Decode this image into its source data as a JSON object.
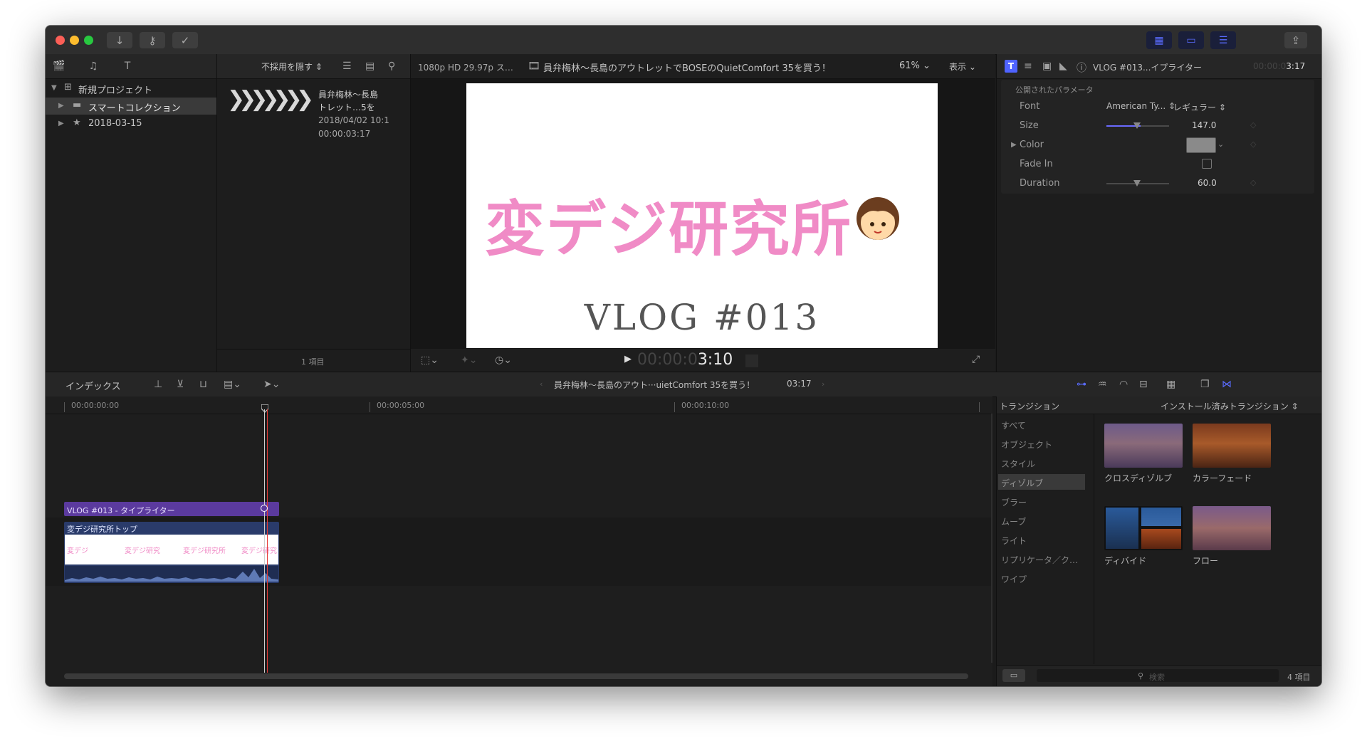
{
  "toolbar": {
    "import_icon": "download-arrow-icon",
    "keyword_icon": "key-icon",
    "background_tasks_icon": "checkmark-circle-icon",
    "share_icon": "share-icon"
  },
  "browser": {
    "filter_label": "不採用を隠す",
    "items": [
      {
        "label": "新規プロジェクト",
        "expanded": true
      },
      {
        "label": "スマートコレクション",
        "selected": true
      },
      {
        "label": "2018-03-15"
      }
    ],
    "clip": {
      "name_line1": "員弁梅林〜長島",
      "name_line2": "トレット…5を",
      "date": "2018/04/02 10:1",
      "duration": "00:00:03:17"
    },
    "item_count": "1 項目"
  },
  "viewer": {
    "format": "1080p HD 29.97p ス…",
    "project_title": "員弁梅林〜長島のアウトレットでBOSEのQuietComfort 35を買う！",
    "zoom": "61%",
    "view_menu": "表示",
    "frame_text_main": "変デジ研究所",
    "frame_text_sub": "VLOG #013",
    "timecode_dim": "00:00:0",
    "timecode_bright": "3:10"
  },
  "inspector": {
    "title": "VLOG #013...イプライター",
    "timecode_dim": "00:00:0",
    "timecode": "3:17",
    "section_label": "公開されたパラメータ",
    "params": [
      {
        "label": "Font",
        "value": "American Ty...",
        "value2": "レギュラー"
      },
      {
        "label": "Size",
        "value": "147.0",
        "level": 0.55
      },
      {
        "label": "Color",
        "value": ""
      },
      {
        "label": "Fade In",
        "value": ""
      },
      {
        "label": "Duration",
        "value": "60.0",
        "level": 0.5
      }
    ]
  },
  "timeline": {
    "index_label": "インデックス",
    "project_label": "員弁梅林〜長島のアウト···uietComfort 35を買う！",
    "project_duration": "03:17",
    "ruler": [
      "00:00:00:00",
      "00:00:05:00",
      "00:00:10:00"
    ],
    "title_clip": "VLOG #013 - タイプライター",
    "video_clip": "変デジ研究所トップ",
    "video_thumbs": [
      "変デジ",
      "変デジ研究",
      "変デジ研究所",
      "変デジ研究"
    ]
  },
  "transitions": {
    "header": "トランジション",
    "installed": "インストール済みトランジション",
    "categories": [
      "すべて",
      "オブジェクト",
      "スタイル",
      "ディゾルブ",
      "ブラー",
      "ムーブ",
      "ライト",
      "リプリケータ／ク…",
      "ワイプ"
    ],
    "selected_category": "ディゾルブ",
    "items": [
      "クロスディゾルブ",
      "カラーフェード",
      "ディバイド",
      "フロー"
    ],
    "search_placeholder": "検索",
    "count": "4 項目"
  },
  "colors": {
    "accent": "#5a6cff",
    "playhead": "#e53935",
    "title_clip": "#5b3a9e",
    "pink_title": "#f08bc6",
    "window_bg": "#1b1b1b"
  }
}
